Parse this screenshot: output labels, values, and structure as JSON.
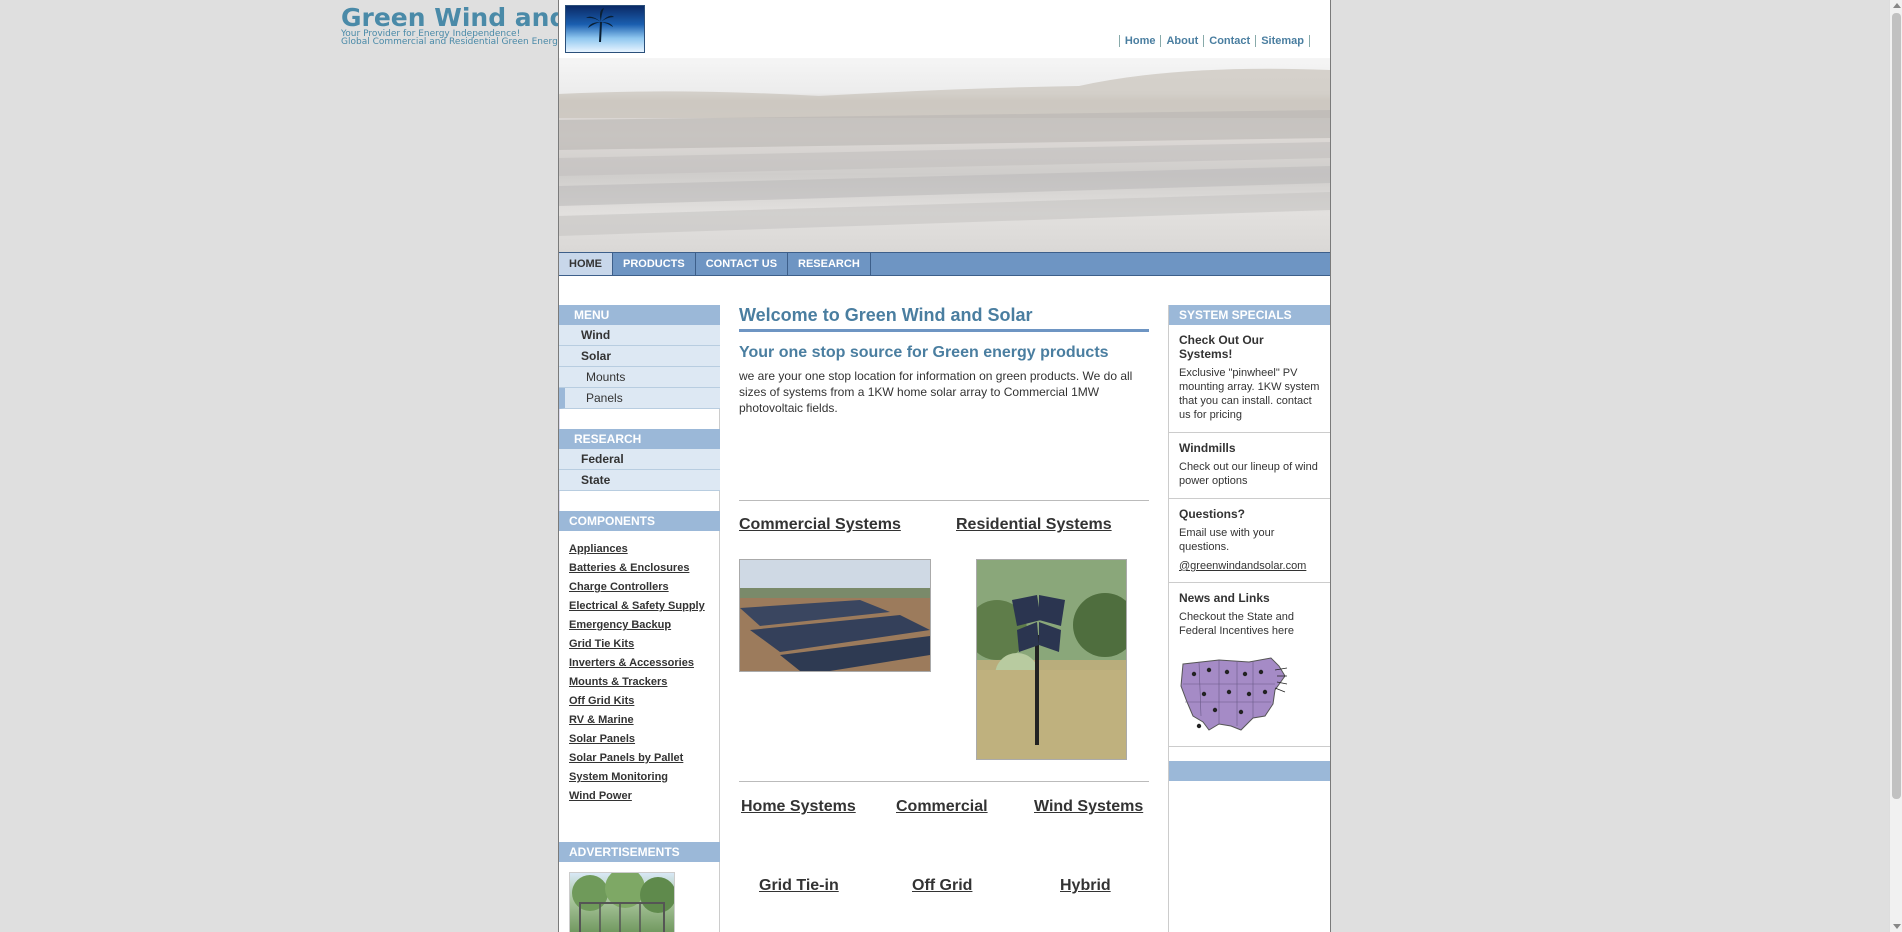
{
  "site": {
    "title": "Green Wind and Solar",
    "tagline1": "Your Provider for Energy Independence!",
    "tagline2": "Global Commercial and Residential Green Energy Specialist"
  },
  "top_links": [
    "Home",
    "About",
    "Contact",
    "Sitemap"
  ],
  "nav_tabs": [
    "HOME",
    "PRODUCTS",
    "CONTACT US",
    "RESEARCH"
  ],
  "left": {
    "menu_heading": "MENU",
    "menu_items": [
      "Wind",
      "Solar",
      "Mounts",
      "Panels"
    ],
    "research_heading": "RESEARCH",
    "research_items": [
      "Federal",
      "State"
    ],
    "components_heading": "COMPONENTS",
    "components": [
      "Appliances",
      "Batteries & Enclosures",
      "Charge Controllers",
      "Electrical & Safety Supply",
      "Emergency Backup",
      "Grid Tie Kits",
      "Inverters & Accessories",
      "Mounts & Trackers",
      "Off Grid Kits",
      "RV & Marine",
      "Solar Panels",
      "Solar Panels by Pallet",
      "System Monitoring",
      "Wind Power"
    ],
    "ads_heading": "ADVERTISEMENTS"
  },
  "main": {
    "title": "Welcome to Green Wind and Solar",
    "subtitle": "Your one stop source for Green energy products",
    "intro": "we are your one stop location for information on green products. We do all sizes of systems from a 1KW home solar array to Commercial 1MW photovoltaic fields.",
    "commercial_systems": "Commercial Systems",
    "residential_systems": "Residential Systems",
    "home_systems": "Home Systems",
    "commercial": "Commercial",
    "wind_systems": "Wind Systems",
    "grid_tie_in": "Grid Tie-in",
    "off_grid": "Off Grid",
    "hybrid": "Hybrid"
  },
  "right": {
    "heading": "SYSTEM SPECIALS",
    "block1_title": "Check Out Our Systems!",
    "block1_text": "Exclusive \"pinwheel\" PV mounting array. 1KW system that you can install. contact us for pricing",
    "block2_title": "Windmills",
    "block2_text": "Check out our lineup of wind power options",
    "block3_title": "Questions?",
    "block3_text": "Email use with your questions.",
    "block3_link": "@greenwindandsolar.com",
    "block4_title": "News and Links",
    "block4_text": "Checkout the State and Federal Incentives here"
  },
  "colors": {
    "accent": "#4a7ea0",
    "nav": "#6e95c3",
    "side_header": "#9bb8d8",
    "side_item": "#dde8f3"
  }
}
